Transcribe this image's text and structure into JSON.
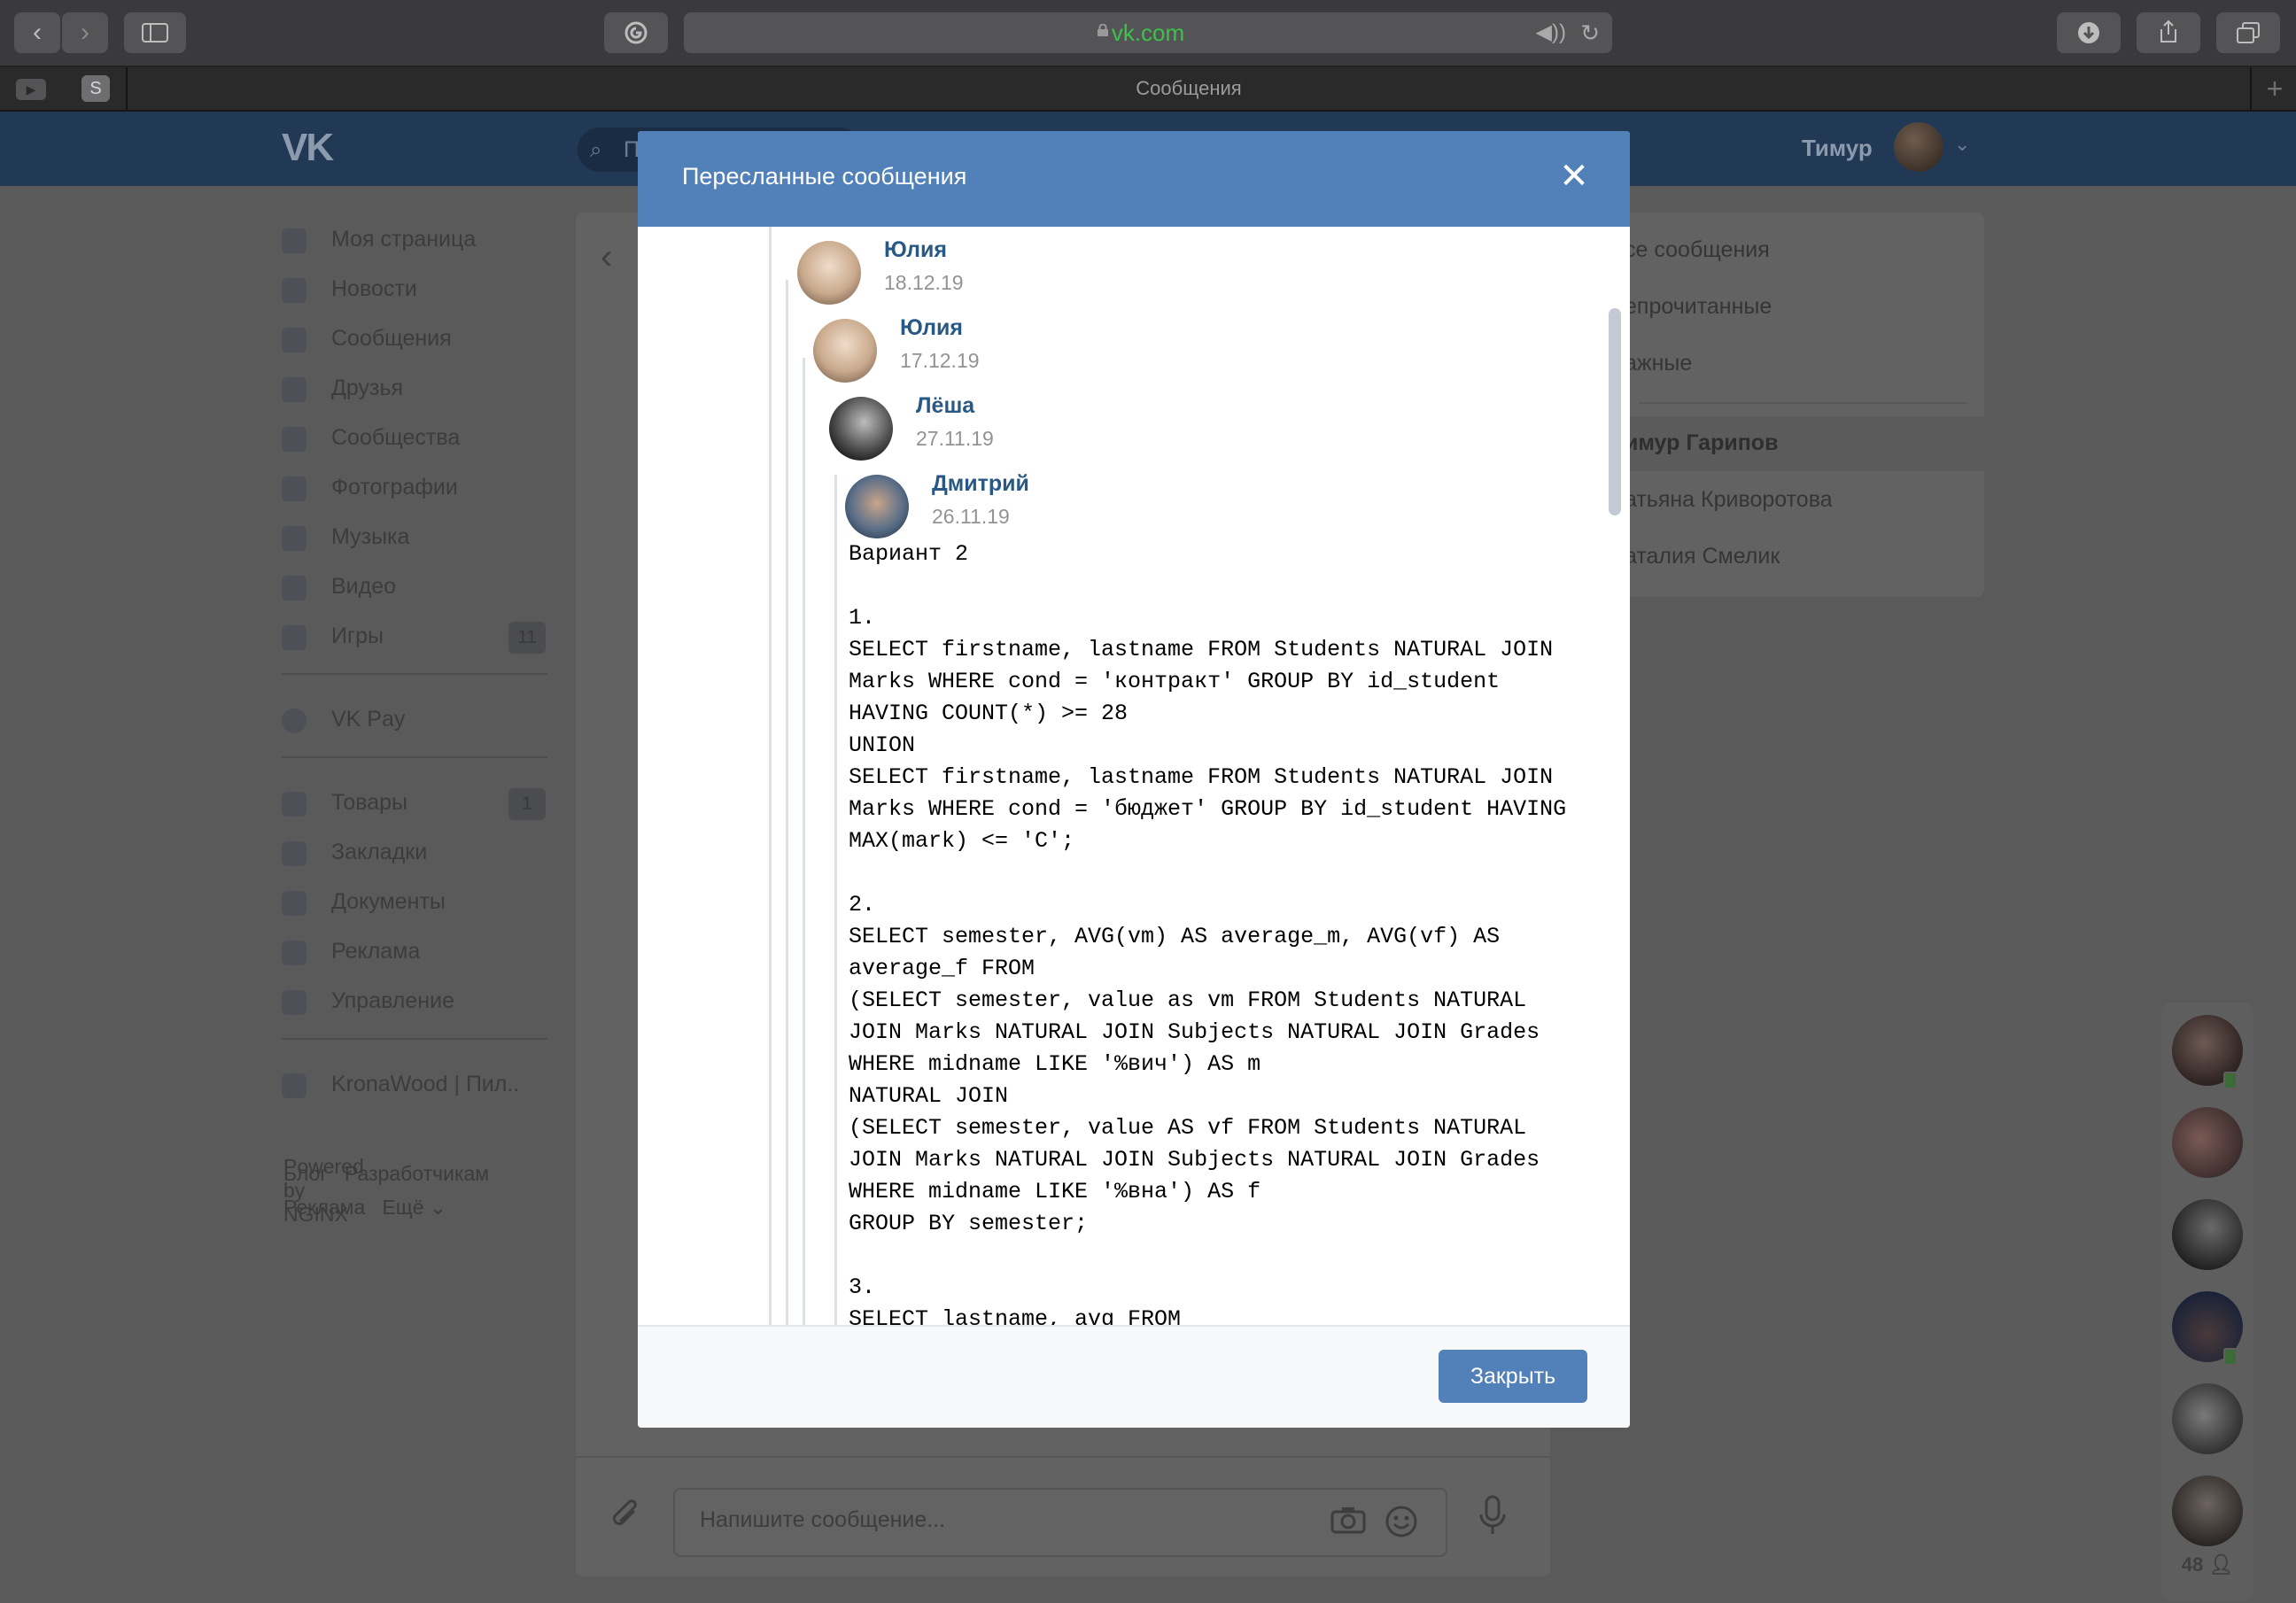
{
  "browser": {
    "url": "vk.com",
    "tab_title": "Сообщения",
    "pinned_tab_label": "S",
    "icons": [
      "chevron-left-icon",
      "chevron-right-icon",
      "sidebar-icon",
      "extension-icon",
      "lock-icon",
      "speaker-icon",
      "reload-icon",
      "download-icon",
      "share-icon",
      "tabs-icon",
      "plus-icon"
    ]
  },
  "vk_header": {
    "user_name": "Тимур",
    "search_placeholder": "П"
  },
  "left_menu": {
    "items": [
      {
        "label": "Моя страница",
        "icon": "home-icon"
      },
      {
        "label": "Новости",
        "icon": "news-icon"
      },
      {
        "label": "Сообщения",
        "icon": "messages-icon"
      },
      {
        "label": "Друзья",
        "icon": "friends-icon"
      },
      {
        "label": "Сообщества",
        "icon": "communities-icon"
      },
      {
        "label": "Фотографии",
        "icon": "camera-icon"
      },
      {
        "label": "Музыка",
        "icon": "music-icon"
      },
      {
        "label": "Видео",
        "icon": "video-icon"
      },
      {
        "label": "Игры",
        "icon": "gamepad-icon",
        "badge": "11"
      },
      {
        "label": "VK Pay",
        "icon": "vkpay-icon"
      },
      {
        "label": "Товары",
        "icon": "bag-icon",
        "badge": "1"
      },
      {
        "label": "Закладки",
        "icon": "star-icon"
      },
      {
        "label": "Документы",
        "icon": "document-icon"
      },
      {
        "label": "Реклама",
        "icon": "megaphone-icon"
      },
      {
        "label": "Управление",
        "icon": "gamepad-icon"
      },
      {
        "label": "KronaWood | Пил..",
        "icon": "group-icon"
      }
    ],
    "powered": "Powered by NGINX",
    "footer": {
      "blog": "Блог",
      "dev": "Разработчикам",
      "ads": "Реклама",
      "more": "Ещё"
    }
  },
  "composer": {
    "placeholder": "Напишите сообщение..."
  },
  "right_panel": {
    "items": [
      "се сообщения",
      "епрочитанные",
      "ажные",
      "имур Гарипов",
      "атьяна Криворотова",
      "аталия Смелик"
    ],
    "active_index": 3
  },
  "chat_dock": {
    "count": "48"
  },
  "modal": {
    "title": "Пересланные сообщения",
    "close_label": "Закрыть",
    "forwards": [
      {
        "name": "Юлия",
        "date": "18.12.19"
      },
      {
        "name": "Юлия",
        "date": "17.12.19"
      },
      {
        "name": "Лёша",
        "date": "27.11.19"
      },
      {
        "name": "Дмитрий",
        "date": "26.11.19"
      }
    ],
    "message_text": "Вариант 2\n\n1.\nSELECT firstname, lastname FROM Students NATURAL JOIN Marks WHERE cond = 'контракт' GROUP BY id_student HAVING COUNT(*) >= 28\nUNION\nSELECT firstname, lastname FROM Students NATURAL JOIN Marks WHERE cond = 'бюджет' GROUP BY id_student HAVING MAX(mark) <= 'C';\n\n2.\nSELECT semester, AVG(vm) AS average_m, AVG(vf) AS average_f FROM\n(SELECT semester, value as vm FROM Students NATURAL JOIN Marks NATURAL JOIN Subjects NATURAL JOIN Grades WHERE midname LIKE '%вич') AS m\nNATURAL JOIN\n(SELECT semester, value AS vf FROM Students NATURAL JOIN Marks NATURAL JOIN Subjects NATURAL JOIN Grades WHERE midname LIKE '%вна') AS f\nGROUP BY semester;\n\n3.\nSELECT lastname, avg FROM"
  }
}
